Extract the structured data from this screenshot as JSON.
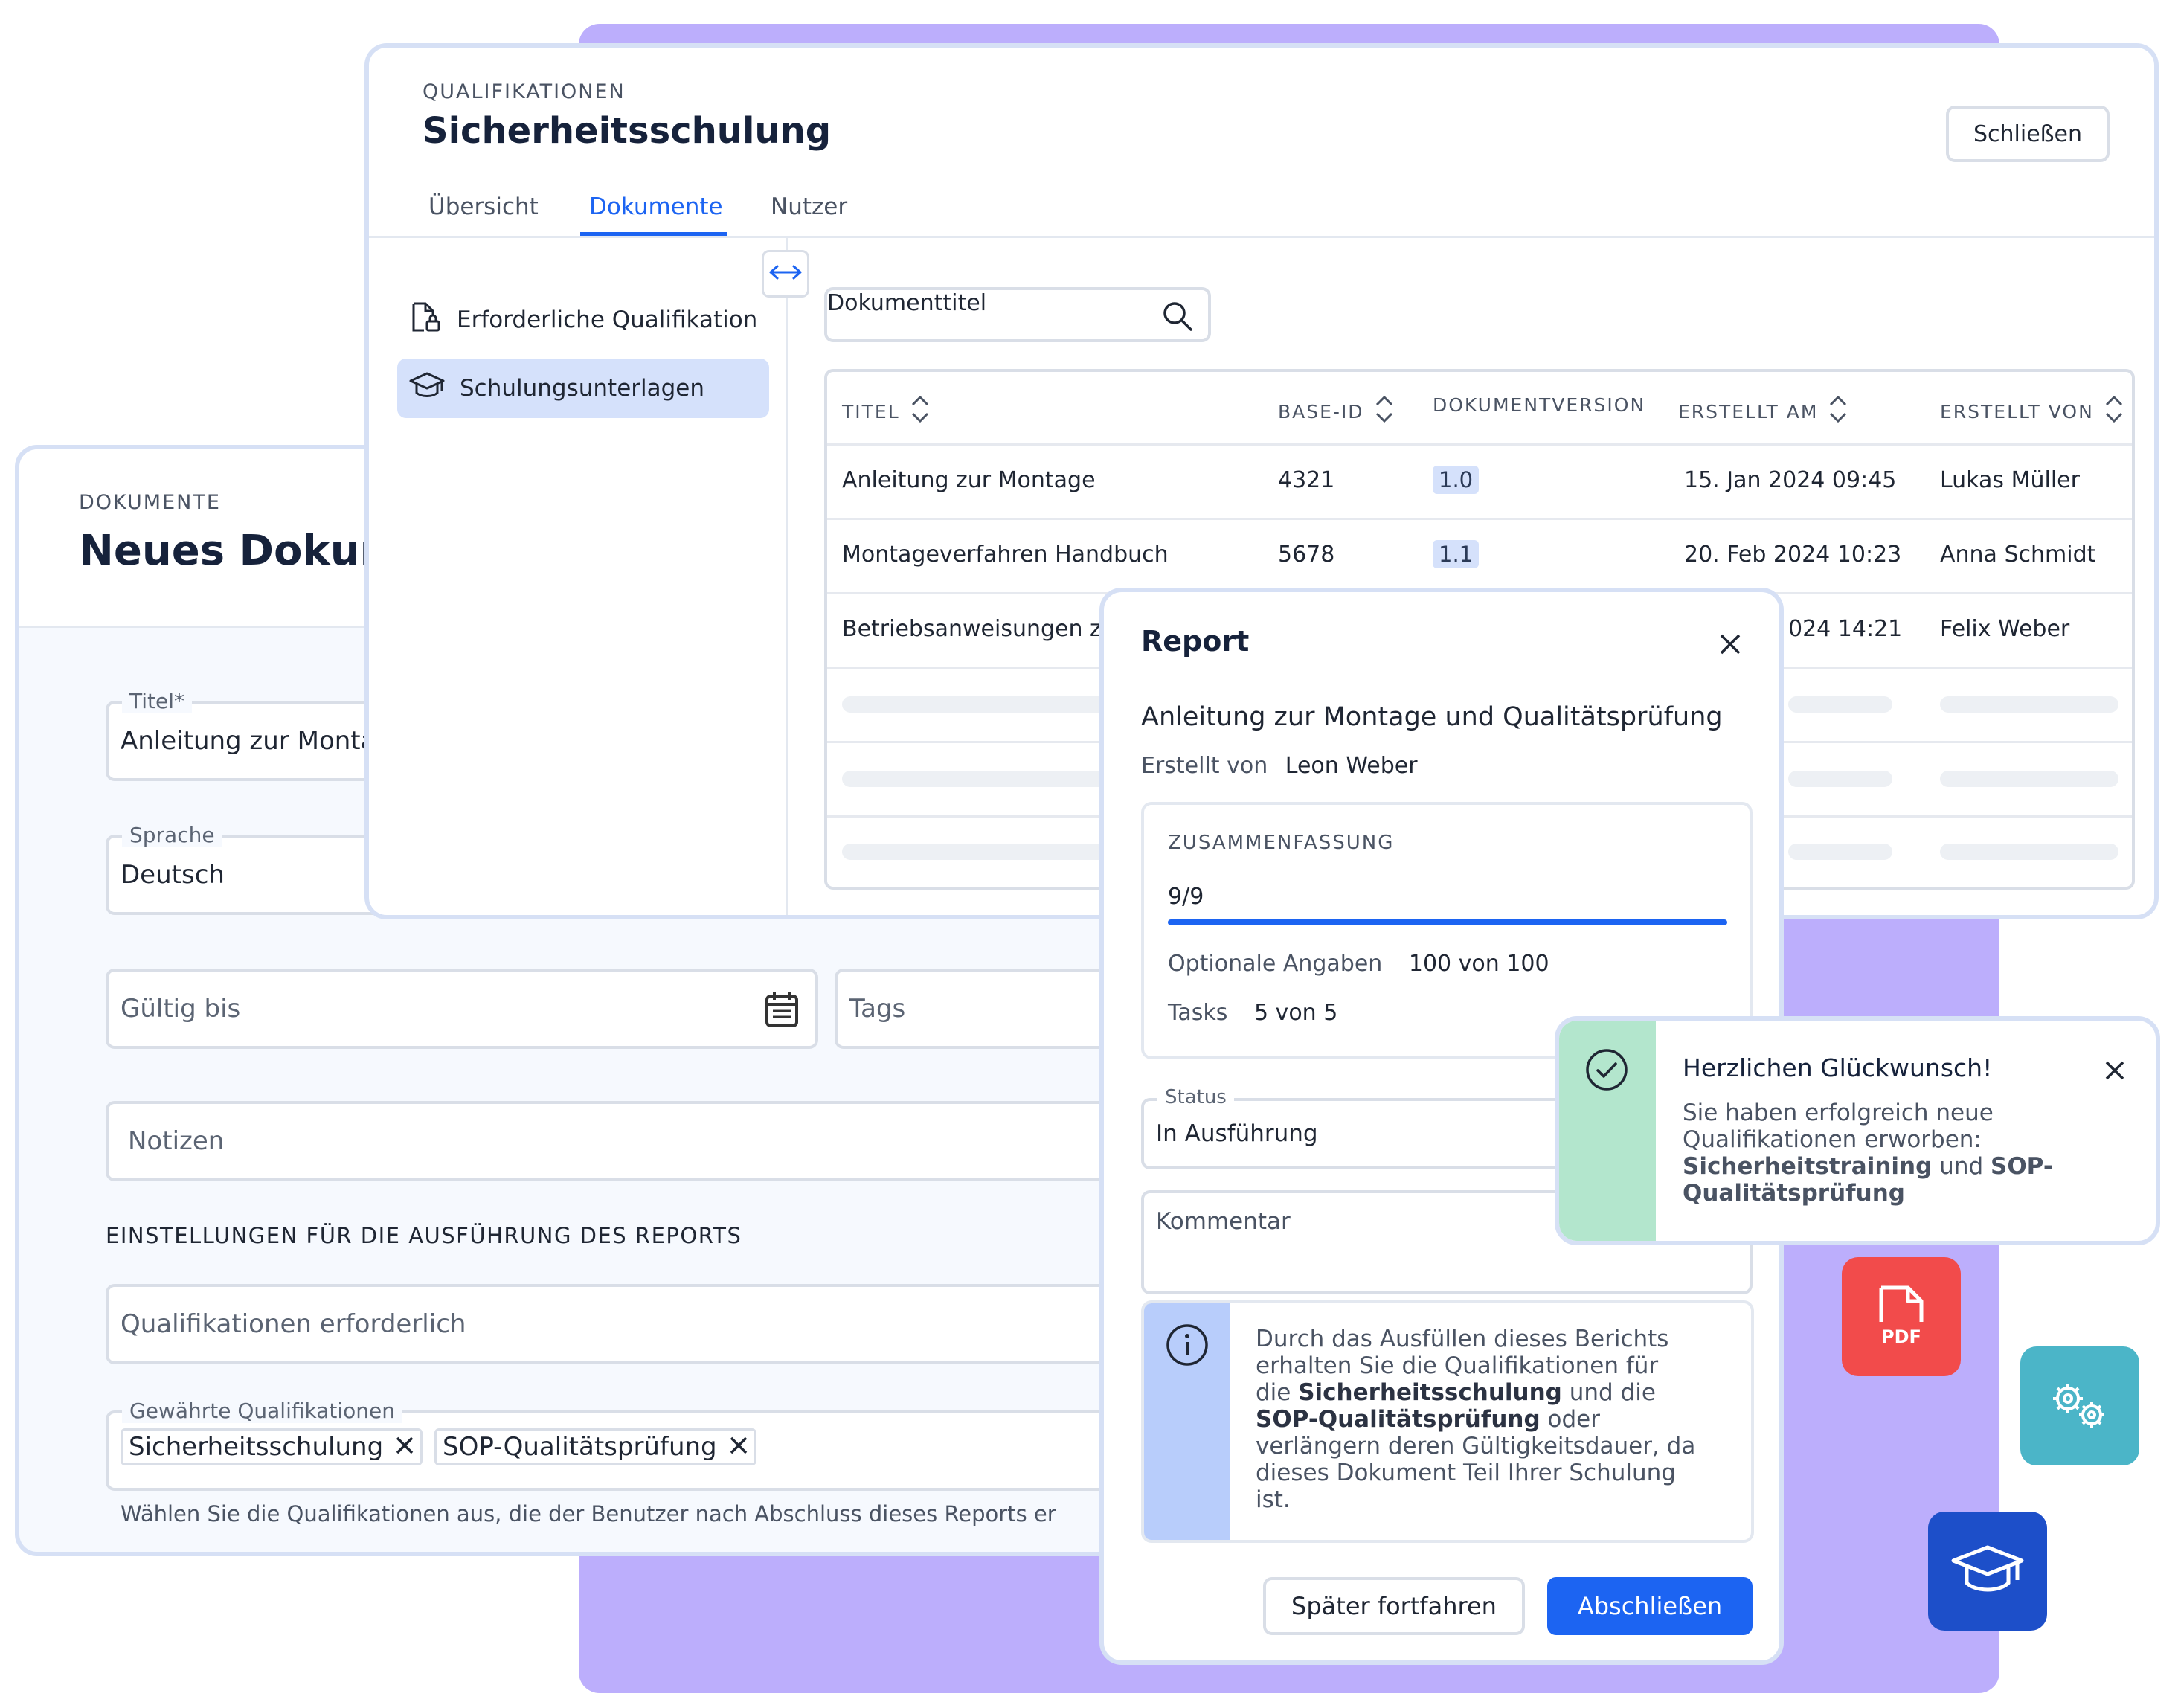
{
  "form": {
    "eyebrow": "DOKUMENTE",
    "title": "Neues Dokum",
    "title_field": {
      "legend": "Titel*",
      "value": "Anleitung zur Monta"
    },
    "language_field": {
      "legend": "Sprache",
      "value": "Deutsch"
    },
    "valid_until": {
      "placeholder": "Gültig bis",
      "icon": "calendar-icon"
    },
    "tags": {
      "placeholder": "Tags"
    },
    "notes": {
      "placeholder": "Notizen"
    },
    "settings_heading": "EINSTELLUNGEN FÜR DIE AUSFÜHRUNG DES REPORTS",
    "quals_required": {
      "placeholder": "Qualifikationen erforderlich"
    },
    "granted": {
      "legend": "Gewährte Qualifikationen",
      "chips": [
        "Sicherheitsschulung",
        "SOP-Qualitätsprüfung"
      ]
    },
    "hint": "Wählen Sie die Qualifikationen aus, die der Benutzer nach Abschluss dieses Reports er"
  },
  "main": {
    "eyebrow": "QUALIFIKATIONEN",
    "title": "Sicherheitsschulung",
    "close_label": "Schließen",
    "tabs": [
      {
        "label": "Übersicht",
        "active": false
      },
      {
        "label": "Dokumente",
        "active": true
      },
      {
        "label": "Nutzer",
        "active": false
      }
    ],
    "sidebar": [
      {
        "label": "Erforderliche Qualifikation",
        "icon": "document-lock-icon",
        "active": false
      },
      {
        "label": "Schulungsunterlagen",
        "icon": "graduation-cap-icon",
        "active": true
      }
    ],
    "search_placeholder": "Dokumenttitel",
    "table": {
      "headers": [
        "TITEL",
        "BASE-ID",
        "DOKUMENTVERSION",
        "ERSTELLT AM",
        "ERSTELLT VON"
      ],
      "rows": [
        {
          "title": "Anleitung zur Montage",
          "base_id": "4321",
          "version": "1.0",
          "created_at": "15. Jan 2024 09:45",
          "created_by": "Lukas Müller"
        },
        {
          "title": "Montageverfahren Handbuch",
          "base_id": "5678",
          "version": "1.1",
          "created_at": "20. Feb 2024 10:23",
          "created_by": "Anna Schmidt"
        },
        {
          "title": "Betriebsanweisungen z",
          "base_id": "",
          "version": "",
          "created_at": "024 14:21",
          "created_by": "Felix Weber"
        }
      ]
    }
  },
  "report": {
    "title": "Report",
    "doc_title": "Anleitung zur Montage und Qualitätsprüfung",
    "created_by_label": "Erstellt von",
    "created_by": "Leon Weber",
    "summary": {
      "heading": "ZUSAMMENFASSUNG",
      "count": "9/9",
      "progress": 1.0,
      "optional_label": "Optionale Angaben",
      "optional_value": "100 von 100",
      "tasks_label": "Tasks",
      "tasks_value": "5 von 5"
    },
    "status": {
      "legend": "Status",
      "value": "In Ausführung"
    },
    "comment_placeholder": "Kommentar",
    "info": {
      "l1": "Durch das Ausfüllen dieses Berichts",
      "l2": "erhalten Sie die Qualifikationen für",
      "l3a": "die ",
      "l3b": "Sicherheitsschulung",
      "l3c": " und die",
      "l4a": "SOP-Qualitätsprüfung",
      "l4b": " oder",
      "l5": "verlängern deren Gültigkeitsdauer, da",
      "l6": "dieses Dokument Teil Ihrer Schulung",
      "l7": "ist."
    },
    "later_label": "Später fortfahren",
    "finish_label": "Abschließen"
  },
  "toast": {
    "title": "Herzlichen Glückwunsch!",
    "l1": "Sie haben erfolgreich neue",
    "l2": "Qualifikationen erworben:",
    "l3a": "Sicherheitstraining",
    "l3b": " und ",
    "l3c": "SOP-",
    "l4": "Qualitätsprüfung"
  },
  "floating_icons": [
    {
      "name": "pdf-icon",
      "label": "PDF",
      "color": "#f24b4b"
    },
    {
      "name": "gears-icon",
      "color": "#4bb5c8"
    },
    {
      "name": "graduation-cap-icon",
      "color": "#1d4fc9"
    }
  ],
  "colors": {
    "accent": "#1c64f2",
    "panel_border": "#d6e0f5",
    "backdrop": "#bcaefc",
    "success": "#b3e6cd",
    "info": "#b8cdfb"
  }
}
